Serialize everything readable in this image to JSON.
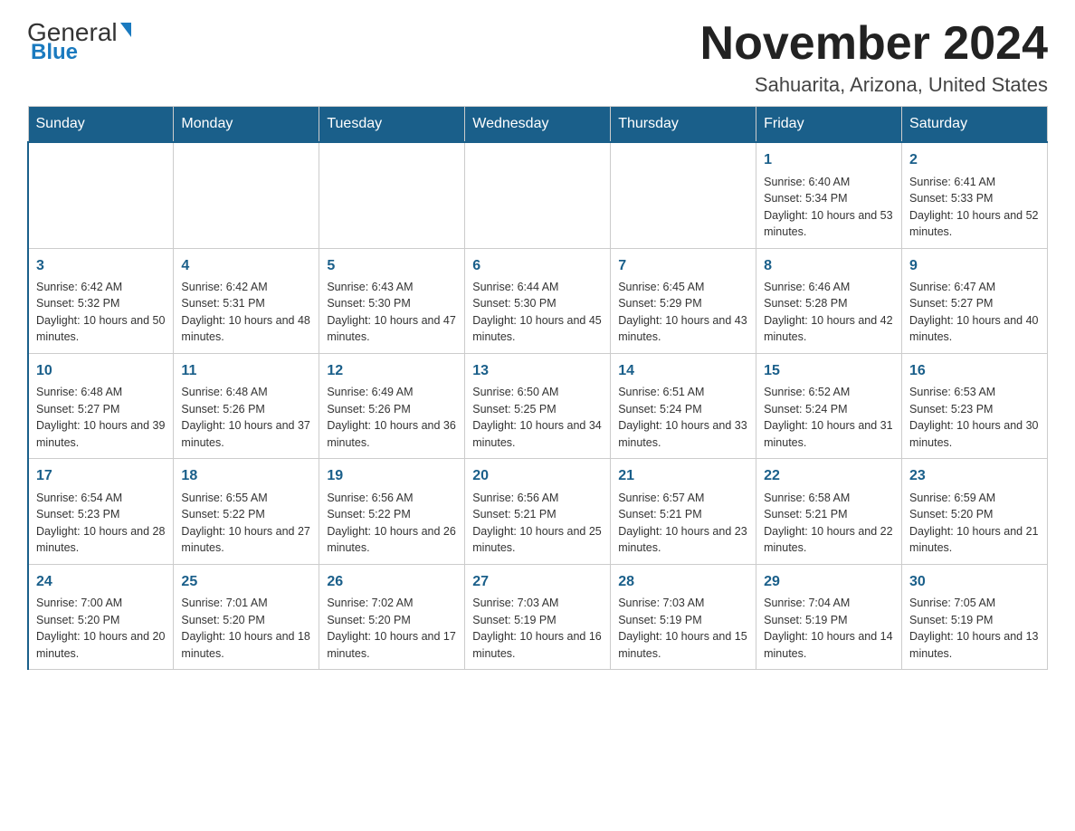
{
  "header": {
    "logo_general": "General",
    "logo_blue": "Blue",
    "title": "November 2024",
    "subtitle": "Sahuarita, Arizona, United States"
  },
  "days_of_week": [
    "Sunday",
    "Monday",
    "Tuesday",
    "Wednesday",
    "Thursday",
    "Friday",
    "Saturday"
  ],
  "weeks": [
    [
      {
        "day": "",
        "info": ""
      },
      {
        "day": "",
        "info": ""
      },
      {
        "day": "",
        "info": ""
      },
      {
        "day": "",
        "info": ""
      },
      {
        "day": "",
        "info": ""
      },
      {
        "day": "1",
        "info": "Sunrise: 6:40 AM\nSunset: 5:34 PM\nDaylight: 10 hours and 53 minutes."
      },
      {
        "day": "2",
        "info": "Sunrise: 6:41 AM\nSunset: 5:33 PM\nDaylight: 10 hours and 52 minutes."
      }
    ],
    [
      {
        "day": "3",
        "info": "Sunrise: 6:42 AM\nSunset: 5:32 PM\nDaylight: 10 hours and 50 minutes."
      },
      {
        "day": "4",
        "info": "Sunrise: 6:42 AM\nSunset: 5:31 PM\nDaylight: 10 hours and 48 minutes."
      },
      {
        "day": "5",
        "info": "Sunrise: 6:43 AM\nSunset: 5:30 PM\nDaylight: 10 hours and 47 minutes."
      },
      {
        "day": "6",
        "info": "Sunrise: 6:44 AM\nSunset: 5:30 PM\nDaylight: 10 hours and 45 minutes."
      },
      {
        "day": "7",
        "info": "Sunrise: 6:45 AM\nSunset: 5:29 PM\nDaylight: 10 hours and 43 minutes."
      },
      {
        "day": "8",
        "info": "Sunrise: 6:46 AM\nSunset: 5:28 PM\nDaylight: 10 hours and 42 minutes."
      },
      {
        "day": "9",
        "info": "Sunrise: 6:47 AM\nSunset: 5:27 PM\nDaylight: 10 hours and 40 minutes."
      }
    ],
    [
      {
        "day": "10",
        "info": "Sunrise: 6:48 AM\nSunset: 5:27 PM\nDaylight: 10 hours and 39 minutes."
      },
      {
        "day": "11",
        "info": "Sunrise: 6:48 AM\nSunset: 5:26 PM\nDaylight: 10 hours and 37 minutes."
      },
      {
        "day": "12",
        "info": "Sunrise: 6:49 AM\nSunset: 5:26 PM\nDaylight: 10 hours and 36 minutes."
      },
      {
        "day": "13",
        "info": "Sunrise: 6:50 AM\nSunset: 5:25 PM\nDaylight: 10 hours and 34 minutes."
      },
      {
        "day": "14",
        "info": "Sunrise: 6:51 AM\nSunset: 5:24 PM\nDaylight: 10 hours and 33 minutes."
      },
      {
        "day": "15",
        "info": "Sunrise: 6:52 AM\nSunset: 5:24 PM\nDaylight: 10 hours and 31 minutes."
      },
      {
        "day": "16",
        "info": "Sunrise: 6:53 AM\nSunset: 5:23 PM\nDaylight: 10 hours and 30 minutes."
      }
    ],
    [
      {
        "day": "17",
        "info": "Sunrise: 6:54 AM\nSunset: 5:23 PM\nDaylight: 10 hours and 28 minutes."
      },
      {
        "day": "18",
        "info": "Sunrise: 6:55 AM\nSunset: 5:22 PM\nDaylight: 10 hours and 27 minutes."
      },
      {
        "day": "19",
        "info": "Sunrise: 6:56 AM\nSunset: 5:22 PM\nDaylight: 10 hours and 26 minutes."
      },
      {
        "day": "20",
        "info": "Sunrise: 6:56 AM\nSunset: 5:21 PM\nDaylight: 10 hours and 25 minutes."
      },
      {
        "day": "21",
        "info": "Sunrise: 6:57 AM\nSunset: 5:21 PM\nDaylight: 10 hours and 23 minutes."
      },
      {
        "day": "22",
        "info": "Sunrise: 6:58 AM\nSunset: 5:21 PM\nDaylight: 10 hours and 22 minutes."
      },
      {
        "day": "23",
        "info": "Sunrise: 6:59 AM\nSunset: 5:20 PM\nDaylight: 10 hours and 21 minutes."
      }
    ],
    [
      {
        "day": "24",
        "info": "Sunrise: 7:00 AM\nSunset: 5:20 PM\nDaylight: 10 hours and 20 minutes."
      },
      {
        "day": "25",
        "info": "Sunrise: 7:01 AM\nSunset: 5:20 PM\nDaylight: 10 hours and 18 minutes."
      },
      {
        "day": "26",
        "info": "Sunrise: 7:02 AM\nSunset: 5:20 PM\nDaylight: 10 hours and 17 minutes."
      },
      {
        "day": "27",
        "info": "Sunrise: 7:03 AM\nSunset: 5:19 PM\nDaylight: 10 hours and 16 minutes."
      },
      {
        "day": "28",
        "info": "Sunrise: 7:03 AM\nSunset: 5:19 PM\nDaylight: 10 hours and 15 minutes."
      },
      {
        "day": "29",
        "info": "Sunrise: 7:04 AM\nSunset: 5:19 PM\nDaylight: 10 hours and 14 minutes."
      },
      {
        "day": "30",
        "info": "Sunrise: 7:05 AM\nSunset: 5:19 PM\nDaylight: 10 hours and 13 minutes."
      }
    ]
  ],
  "colors": {
    "header_bg": "#1a5f8a",
    "header_text": "#ffffff",
    "day_num_color": "#1a5f8a",
    "border_color": "#cccccc",
    "logo_blue": "#1a7abf"
  }
}
